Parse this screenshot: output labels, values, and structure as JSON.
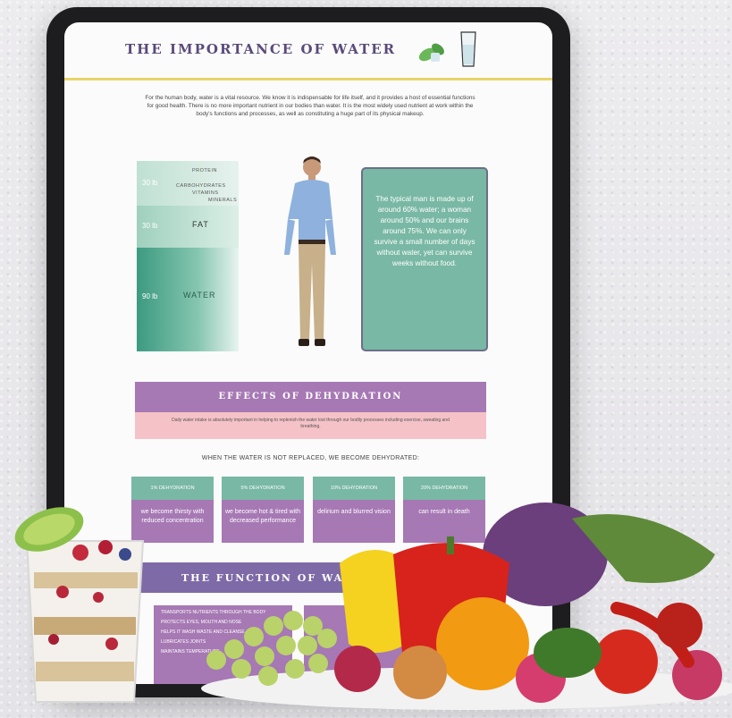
{
  "page": {
    "title": "THE IMPORTANCE OF WATER",
    "intro": "For the human body, water is a vital resource. We know it is indispensable for life itself, and it provides a host of essential functions for good health. There is no more important nutrient in our bodies than water. It is the most widely used nutrient at work within the body's functions and processes, as well as constituting a huge part of its physical makeup."
  },
  "composition": {
    "top_value": "30 lb",
    "top_items": [
      "PROTEIN",
      "CARBOHYDRATES",
      "VITAMINS",
      "MINERALS"
    ],
    "mid_value": "30 lb",
    "mid_label": "FAT",
    "bottom_value": "90 lb",
    "bottom_label": "WATER"
  },
  "fact_box": "The typical man is made up of around 60% water; a woman around 50% and our brains around 75%. We can only survive a small number of days without water, yet can survive weeks without food.",
  "dehydration": {
    "heading": "EFFECTS OF DEHYDRATION",
    "subtext": "Daily water intake is absolutely important in helping to replenish the water lost through our bodily processes including exercise, sweating and breathing.",
    "when": "WHEN THE WATER IS NOT REPLACED, WE BECOME DEHYDRATED:",
    "cards": [
      {
        "head": "1% DEHYDRATION",
        "body": "we become thirsty with reduced concentration"
      },
      {
        "head": "5% DEHYDRATION",
        "body": "we become hot & tired with decreased performance"
      },
      {
        "head": "10% DEHYDRATION",
        "body": "delirium and blurred vision"
      },
      {
        "head": "20% DEHYDRATION",
        "body": "can result in death"
      }
    ]
  },
  "function": {
    "heading": "THE FUNCTION OF WATER",
    "items": [
      "TRANSPORTS NUTRIENTS THROUGH THE BODY",
      "PROTECTS EYES, MOUTH AND NOSE",
      "HELPS IT WASH WASTE AND CLEANSE",
      "LUBRICATES JOINTS",
      "MAINTAINS TEMPERATURE"
    ]
  },
  "colors": {
    "accent_green": "#79b8a4",
    "accent_purple": "#a678b4",
    "accent_yellow": "#e8d468"
  }
}
